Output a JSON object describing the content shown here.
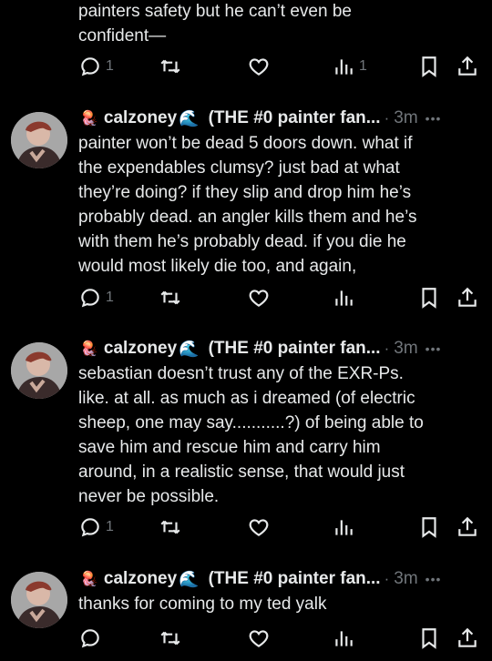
{
  "top_post": {
    "text": "painters safety but he can’t even be\nconfident—",
    "reply_count": "1",
    "views_count": "1"
  },
  "posts": [
    {
      "emoji": "🪼",
      "name": "calzoney",
      "wave": "🌊",
      "handle": "(THE #0 painter fan...",
      "separator": "·",
      "time": "3m",
      "more": "•••",
      "text": "painter won’t be dead 5 doors down. what if\nthe expendables clumsy? just bad at what\nthey’re doing? if they slip and drop him he’s\nprobably dead. an angler kills them and he’s\nwith them he’s probably dead. if you die he\nwould most likely die too, and again,",
      "reply_count": "1"
    },
    {
      "emoji": "🪼",
      "name": "calzoney",
      "wave": "🌊",
      "handle": "(THE #0 painter fan...",
      "separator": "·",
      "time": "3m",
      "more": "•••",
      "text": "sebastian doesn’t trust any of the EXR-Ps.\nlike. at all. as much as i dreamed (of electric\nsheep, one may say...........?) of being able to\nsave him and rescue him and carry him\naround, in a realistic sense, that would just\nnever be possible.",
      "reply_count": "1"
    },
    {
      "emoji": "🪼",
      "name": "calzoney",
      "wave": "🌊",
      "handle": "(THE #0 painter fan...",
      "separator": "·",
      "time": "3m",
      "more": "•••",
      "text": "thanks for coming to my ted yalk",
      "reply_count": ""
    }
  ],
  "icons": [
    "reply-icon",
    "repost-icon",
    "like-icon",
    "views-icon",
    "bookmark-icon",
    "share-icon",
    "jellyfish-emoji",
    "wave-emoji"
  ],
  "colors": {
    "background": "#000000",
    "text": "#e7e9ea",
    "muted": "#71767b"
  }
}
